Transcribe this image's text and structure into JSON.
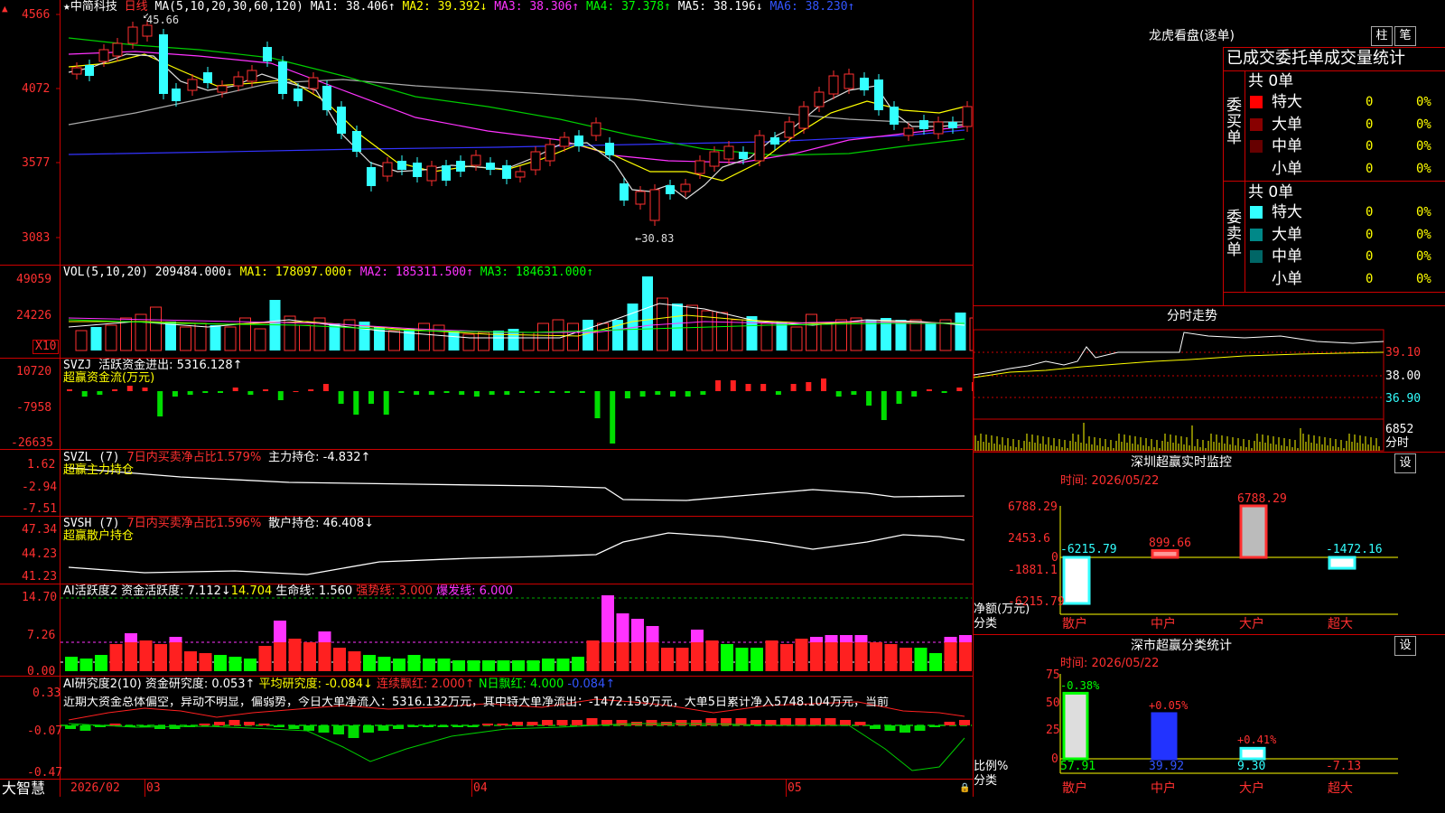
{
  "main": {
    "star": "★",
    "stock_name": "中简科技",
    "period": "日线",
    "ma_prefix": "MA(5,10,20,30,60,120)",
    "ma1": "MA1: 38.406↑",
    "ma2": "MA2: 39.392↓",
    "ma3": "MA3: 38.306↑",
    "ma4": "MA4: 37.378↑",
    "ma5": "MA5: 38.196↓",
    "ma6": "MA6: 38.230↑",
    "y_ticks": [
      "4566",
      "4072",
      "3577",
      "3083"
    ],
    "high_mark": "45.66",
    "low_mark": "←30.83",
    "high_arrow": "↙"
  },
  "vol": {
    "label": "VOL(5,10,20)",
    "value": "209484.000↓",
    "ma1": "MA1: 178097.000↑",
    "ma2": "MA2: 185311.500↑",
    "ma3": "MA3: 184631.000↑",
    "y_ticks": [
      "49059",
      "24226"
    ],
    "unit": "X10"
  },
  "svzj": {
    "label": "SVZJ",
    "value": "活跃资金进出: 5316.128↑",
    "sub": "超赢资金流(万元)",
    "y_ticks": [
      "10720",
      "-7958",
      "-26635"
    ]
  },
  "svzl": {
    "label": "SVZL (7)",
    "pct": "7日内买卖净占比1.579%",
    "value": "主力持仓: -4.832↑",
    "sub": "超赢主力持仓",
    "y_ticks": [
      "1.62",
      "-2.94",
      "-7.51"
    ]
  },
  "svsh": {
    "label": "SVSH (7)",
    "pct": "7日内买卖净占比1.596%",
    "value": "散户持仓: 46.408↓",
    "sub": "超赢散户持仓",
    "y_ticks": [
      "47.34",
      "44.23",
      "41.23"
    ]
  },
  "ai1": {
    "label": "AI活跃度2",
    "v1": "资金活跃度: 7.112↓",
    "v2": "14.704",
    "v3": "生命线: 1.560",
    "v4": "强势线: 3.000",
    "v5": "爆发线: 6.000",
    "y_ticks": [
      "14.70",
      "7.26",
      "0.00"
    ]
  },
  "ai2": {
    "label": "AI研究度2(10)",
    "v1": "资金研究度: 0.053↑",
    "v2": "平均研究度: -0.084↓",
    "v3": "连续飘红: 2.000↑",
    "v4": "N日飘红: 4.000",
    "v5": "-0.084↑",
    "desc": "近期大资金总体偏空，异动不明显，偏弱势，今日大单净流入：5316.132万元，其中特大单净流出：-1472.159万元，大单5日累计净入5748.104万元，当前",
    "y_ticks": [
      "0.33",
      "-0.07",
      "-0.47"
    ]
  },
  "bottom": {
    "brand": "大智慧",
    "dates": [
      "2026/02",
      "03",
      "04",
      "05"
    ]
  },
  "longhu": {
    "title": "龙虎看盘(逐单)",
    "btn1": "柱",
    "btn2": "笔",
    "subtitle": "已成交委托单成交量统计",
    "buy_label": "委买单",
    "sell_label": "委卖单",
    "buy_total": "共 0单",
    "sell_total": "共 0单",
    "buy_rows": [
      {
        "name": "特大",
        "count": "0",
        "pct": "0%",
        "color": "#ff0000"
      },
      {
        "name": "大单",
        "count": "0",
        "pct": "0%",
        "color": "#880000"
      },
      {
        "name": "中单",
        "count": "0",
        "pct": "0%",
        "color": "#660000"
      },
      {
        "name": "小单",
        "count": "0",
        "pct": "0%",
        "color": "#000000"
      }
    ],
    "sell_rows": [
      {
        "name": "特大",
        "count": "0",
        "pct": "0%",
        "color": "#33ffff"
      },
      {
        "name": "大单",
        "count": "0",
        "pct": "0%",
        "color": "#008888"
      },
      {
        "name": "中单",
        "count": "0",
        "pct": "0%",
        "color": "#006666"
      },
      {
        "name": "小单",
        "count": "0",
        "pct": "0%",
        "color": "#000000"
      }
    ]
  },
  "fenshi": {
    "title": "分时走势",
    "p1": "39.10",
    "p2": "38.00",
    "p3": "36.90",
    "vol": "6852",
    "unit": "分时"
  },
  "sz_monitor": {
    "title": "深圳超赢实时监控",
    "btn": "设",
    "time_label": "时间: 2026/05/22",
    "y_ticks": [
      "6788.29",
      "2453.6",
      "0",
      "-1881.1",
      "-6215.79"
    ],
    "ylabel1": "净额(万元)",
    "ylabel2": "分类",
    "categories": [
      "散户",
      "中户",
      "大户",
      "超大"
    ],
    "values": [
      -6215.79,
      899.66,
      6788.29,
      -1472.16
    ],
    "value_labels": [
      "-6215.79",
      "899.66",
      "6788.29",
      "-1472.16"
    ]
  },
  "sz_class": {
    "title": "深市超赢分类统计",
    "btn": "设",
    "time_label": "时间: 2026/05/22",
    "y_ticks": [
      "75",
      "50",
      "25",
      "0"
    ],
    "ylabel1": "比例%",
    "ylabel2": "分类",
    "categories": [
      "散户",
      "中户",
      "大户",
      "超大"
    ],
    "values": [
      57.91,
      39.92,
      9.3,
      -7.13
    ],
    "value_labels": [
      "57.91",
      "39.92",
      "9.30",
      "-7.13"
    ],
    "changes": [
      "-0.38%",
      "+0.05%",
      "+0.41%",
      ""
    ]
  }
}
